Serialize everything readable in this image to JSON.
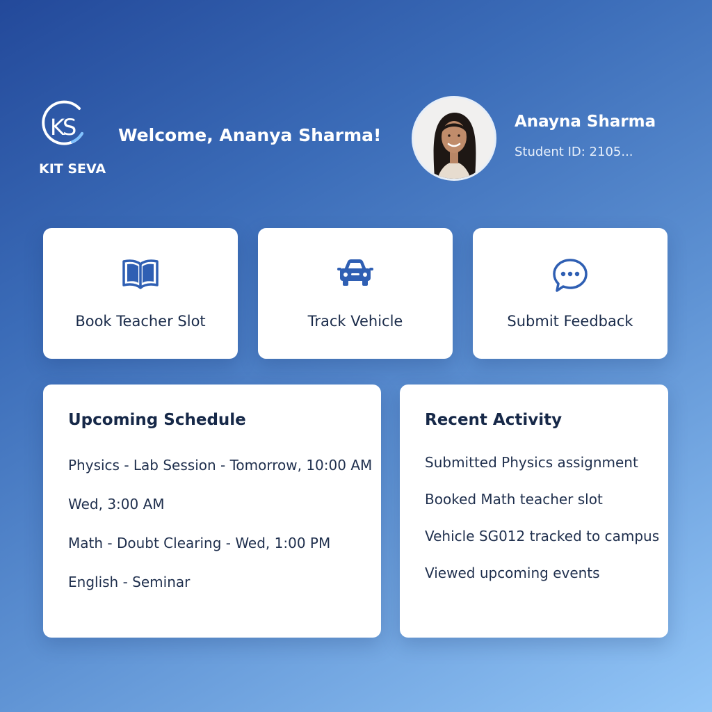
{
  "brand": {
    "logo_mark": "KS",
    "name": "KIT SEVA"
  },
  "header": {
    "welcome": "Welcome, Ananya Sharma!"
  },
  "profile": {
    "name": "Anayna Sharma",
    "student_id": "Student ID: 2105..."
  },
  "actions": [
    {
      "label": "Book Teacher Slot",
      "icon": "book-icon"
    },
    {
      "label": "Track Vehicle",
      "icon": "car-icon"
    },
    {
      "label": "Submit Feedback",
      "icon": "chat-bubble-icon"
    }
  ],
  "schedule": {
    "title": "Upcoming Schedule",
    "items": [
      "Physics - Lab Session - Tomorrow, 10:00 AM",
      "Wed, 3:00 AM",
      "Math - Doubt Clearing - Wed, 1:00 PM",
      "English - Seminar"
    ]
  },
  "activity": {
    "title": "Recent Activity",
    "items": [
      "Submitted Physics assignment",
      "Booked Math teacher slot",
      "Vehicle SG012 tracked to campus",
      "Viewed upcoming events"
    ]
  },
  "colors": {
    "accent": "#2f5fb3",
    "background_start": "#23499a",
    "background_end": "#93c6f7"
  }
}
